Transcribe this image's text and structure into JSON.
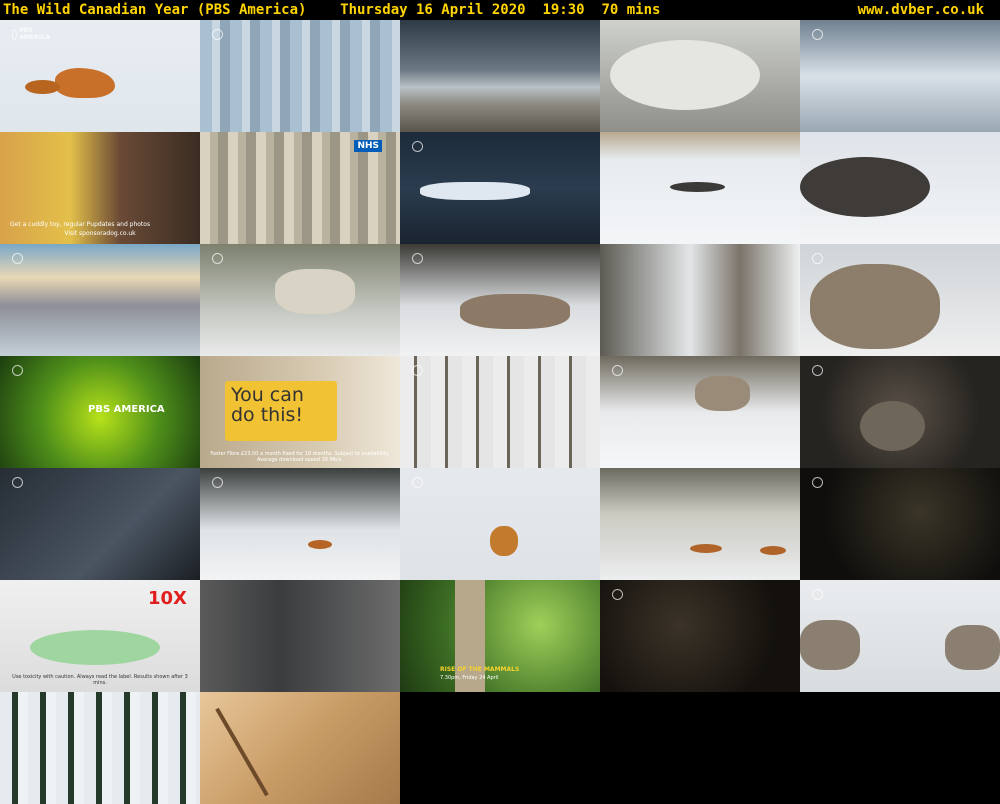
{
  "header": {
    "left_text": "The Wild Canadian Year (PBS America)    Thursday 16 April 2020  19:30  70 mins",
    "site": "www.dvber.co.uk"
  },
  "thumbs": {
    "t1": {
      "wm": "PBS AMERICA"
    },
    "t6": {
      "caption": "Get a cuddly toy, regular Pupdates and photos",
      "caption2": "Visit sponsoradog.co.uk"
    },
    "t7": {
      "badge": "NHS"
    },
    "t16": {
      "logo": "PBS AMERICA"
    },
    "t17": {
      "headline": "You can do this!",
      "small": "Faster Fibre £23.50 a month fixed for 18 months. Subject to availability. Average download speed 38 Mb/s."
    },
    "t26": {
      "headline": "10X",
      "caption": "Use toxicity with caution. Always read the label. Results shown after 3 mins."
    },
    "t28": {
      "title": "RISE OF THE MAMMALS",
      "subtitle": "7.30pm, Friday 24 April"
    }
  },
  "colors": {
    "header_bg": "#000000",
    "header_text": "#ffd400"
  }
}
